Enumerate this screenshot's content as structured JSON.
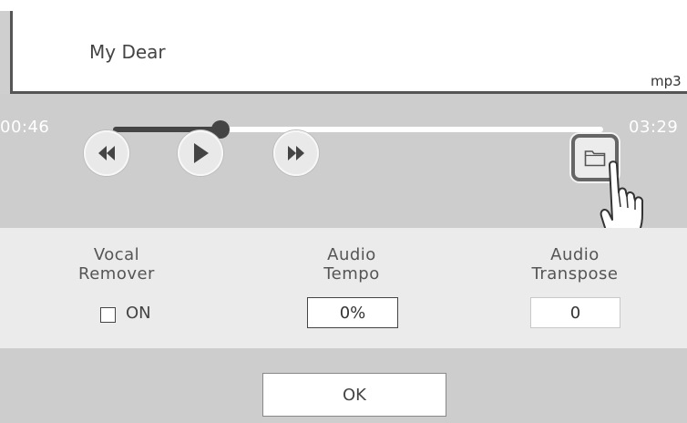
{
  "song": {
    "name": "My Dear",
    "format": "mp3"
  },
  "player": {
    "current_time": "00:46",
    "total_time": "03:29",
    "progress": 0.22
  },
  "settings": {
    "vocal_remover": {
      "label_line1": "Vocal",
      "label_line2": "Remover",
      "checkbox_label": "ON",
      "checked": false
    },
    "audio_tempo": {
      "label_line1": "Audio",
      "label_line2": "Tempo",
      "value": "0%"
    },
    "audio_transpose": {
      "label_line1": "Audio",
      "label_line2": "Transpose",
      "value": "0"
    }
  },
  "footer": {
    "ok_label": "OK"
  },
  "icons": [
    "rewind-icon",
    "play-icon",
    "fast-forward-icon",
    "folder-icon",
    "pointing-hand-icon"
  ],
  "colors": {
    "panel": "#cdcdcd",
    "settings_bg": "#ebebeb",
    "dark": "#444444"
  }
}
